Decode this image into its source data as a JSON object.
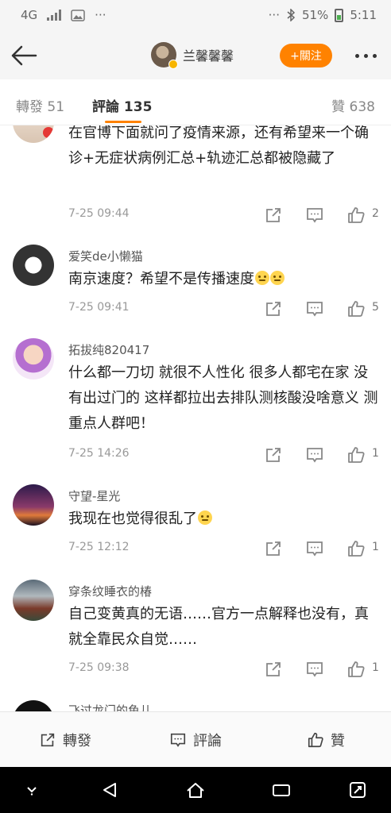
{
  "status_bar": {
    "network": "4G",
    "more": "···",
    "right_more": "···",
    "battery": "51%",
    "time": "5:11"
  },
  "nav": {
    "username": "兰馨馨馨",
    "follow_label": "+關注"
  },
  "tabs": {
    "forward": "轉發 51",
    "comment": "評論 135",
    "like": "贊 638"
  },
  "comments": [
    {
      "username": "",
      "text": "在官博下面就问了疫情来源，还有希望来一个确诊+无症状病例汇总+轨迹汇总都被隐藏了",
      "time": "7-25 09:44",
      "likes": "2"
    },
    {
      "username": "爱笑de小懒猫",
      "text": "南京速度？希望不是传播速度",
      "time": "7-25 09:41",
      "likes": "5"
    },
    {
      "username": "拓拔纯820417",
      "text": "什么都一刀切 就很不人性化 很多人都宅在家 没有出过门的 这样都拉出去排队测核酸没啥意义 测重点人群吧！",
      "time": "7-25 14:26",
      "likes": "1"
    },
    {
      "username": "守望-星光",
      "text": "我现在也觉得很乱了",
      "time": "7-25 12:12",
      "likes": "1"
    },
    {
      "username": "穿条纹睡衣的椿",
      "text": "自己变黄真的无语……官方一点解释也没有，真就全靠民众自觉……",
      "time": "7-25 09:38",
      "likes": "1"
    },
    {
      "username": "飞过龙门的鱼儿"
    }
  ],
  "action_bar": {
    "forward": "轉發",
    "comment": "評論",
    "like": "贊"
  },
  "colors": {
    "accent": "#ff8200",
    "background": "#f5f5f5"
  }
}
